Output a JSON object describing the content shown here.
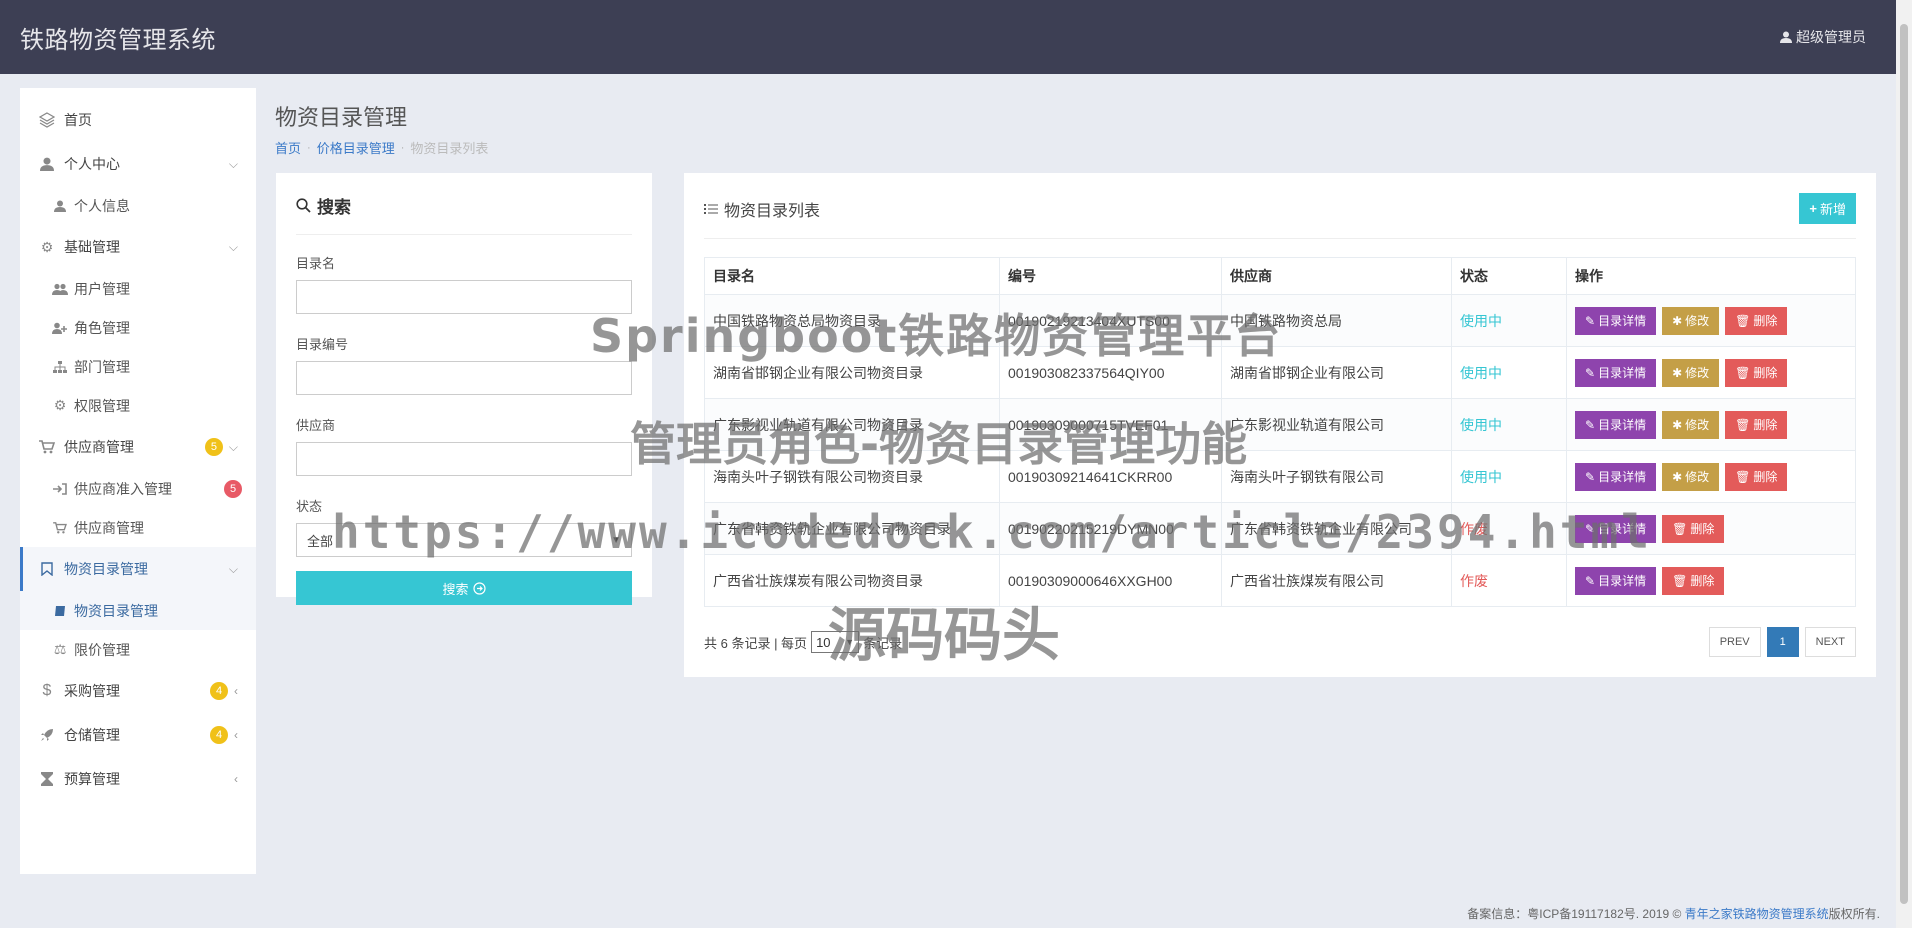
{
  "header": {
    "brand": "铁路物资管理系统",
    "user": "超级管理员"
  },
  "sidebar": {
    "home": "首页",
    "personal": "个人中心",
    "personal_info": "个人信息",
    "basic": "基础管理",
    "users": "用户管理",
    "roles": "角色管理",
    "depts": "部门管理",
    "perms": "权限管理",
    "supplier": "供应商管理",
    "supplier_badge": "5",
    "supplier_access": "供应商准入管理",
    "supplier_access_badge": "5",
    "supplier_mgmt": "供应商管理",
    "catalog": "物资目录管理",
    "catalog_sub": "物资目录管理",
    "price_limit": "限价管理",
    "purchase": "采购管理",
    "purchase_badge": "4",
    "storage": "仓储管理",
    "storage_badge": "4",
    "budget": "预算管理"
  },
  "page": {
    "title": "物资目录管理",
    "breadcrumb": [
      "首页",
      "价格目录管理",
      "物资目录列表"
    ]
  },
  "search": {
    "title": "搜索",
    "name_label": "目录名",
    "code_label": "目录编号",
    "supplier_label": "供应商",
    "status_label": "状态",
    "status_value": "全部",
    "button": "搜索"
  },
  "list": {
    "title": "物资目录列表",
    "add_button": "新增",
    "columns": [
      "目录名",
      "编号",
      "供应商",
      "状态",
      "操作"
    ],
    "detail_label": "目录详情",
    "edit_label": "修改",
    "delete_label": "删除",
    "rows": [
      {
        "name": "中国铁路物资总局物资目录",
        "code": "00190219213404XUTS00",
        "supplier": "中国铁路物资总局",
        "status": "使用中"
      },
      {
        "name": "湖南省邯钢企业有限公司物资目录",
        "code": "001903082337564QIY00",
        "supplier": "湖南省邯钢企业有限公司",
        "status": "使用中"
      },
      {
        "name": "广东影视业轨道有限公司物资目录",
        "code": "00190309000715TVEF01",
        "supplier": "广东影视业轨道有限公司",
        "status": "使用中"
      },
      {
        "name": "海南头叶子钢铁有限公司物资目录",
        "code": "00190309214641CKRR00",
        "supplier": "海南头叶子钢铁有限公司",
        "status": "使用中"
      },
      {
        "name": "广东省韩资铁轨企业有限公司物资目录",
        "code": "00190220215219DYMN00",
        "supplier": "广东省韩资铁轨企业有限公司",
        "status": "作废"
      },
      {
        "name": "广西省壮族煤炭有限公司物资目录",
        "code": "00190309000646XXGH00",
        "supplier": "广西省壮族煤炭有限公司",
        "status": "作废"
      }
    ],
    "record_prefix": "共 6 条记录 | 每页",
    "page_size": "10",
    "record_suffix": "条记录",
    "prev": "PREV",
    "page": "1",
    "next": "NEXT"
  },
  "footer": {
    "prefix": "备案信息：粤ICP备19117182号. 2019 ©",
    "link": "青年之家铁路物资管理系统",
    "suffix": "版权所有."
  },
  "watermark": {
    "line1": "Springboot铁路物资管理平台",
    "line2": "管理员角色-物资目录管理功能",
    "line3": "https://www.icodedock.com/article/2394.html",
    "line4": "源码码头"
  },
  "colors": {
    "header_bg": "#3d3f54",
    "accent_cyan": "#36c6d3",
    "purple": "#8e44ad",
    "gold": "#c49f47",
    "red": "#e35b5a",
    "blue": "#337ab7"
  }
}
